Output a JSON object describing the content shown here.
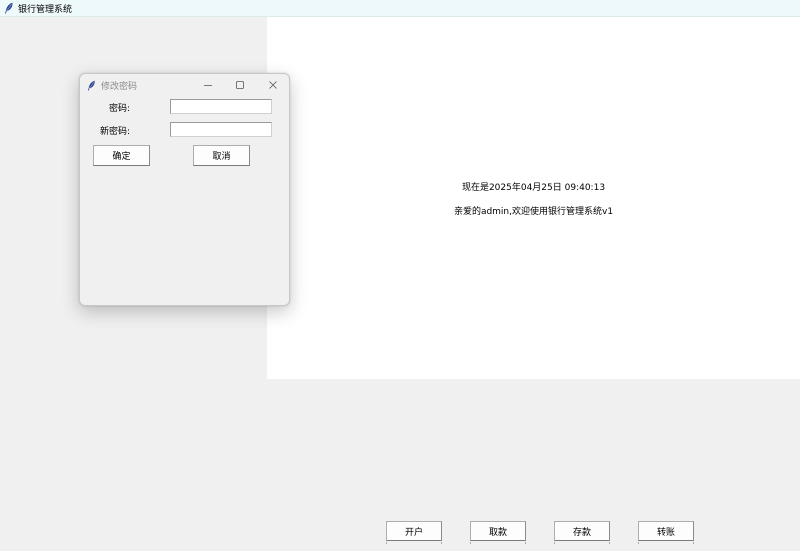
{
  "window": {
    "title": "银行管理系统",
    "icon": "feather-icon"
  },
  "main": {
    "time_text": "现在是2025年04月25日 09:40:13",
    "welcome_text": "亲爱的admin,欢迎使用银行管理系统v1"
  },
  "bottom_buttons": [
    {
      "label": "开户"
    },
    {
      "label": "取款"
    },
    {
      "label": "存款"
    },
    {
      "label": "转账"
    }
  ],
  "dialog": {
    "title": "修改密码",
    "icon": "feather-icon",
    "controls": [
      "minimize-icon",
      "maximize-icon",
      "close-icon"
    ],
    "fields": [
      {
        "label": "密码:",
        "value": "",
        "placeholder": ""
      },
      {
        "label": "新密码:",
        "value": "",
        "placeholder": ""
      }
    ],
    "confirm_label": "确定",
    "cancel_label": "取消"
  },
  "colors": {
    "titlebar_bg": "#eef9fb",
    "window_bg": "#f0f0f0",
    "panel_bg": "#ffffff",
    "feather": "#2b3f8c"
  }
}
